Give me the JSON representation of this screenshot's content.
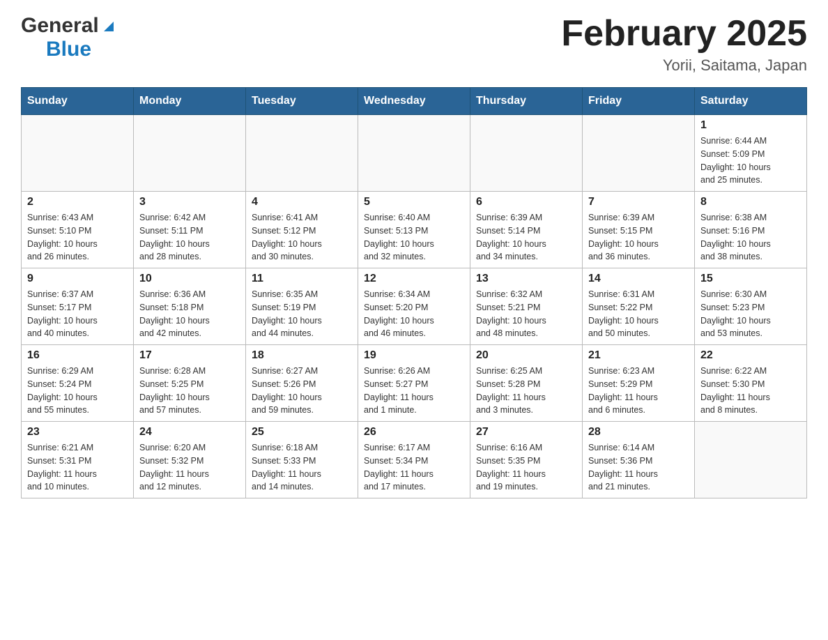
{
  "header": {
    "logo_general": "General",
    "logo_blue": "Blue",
    "month_title": "February 2025",
    "location": "Yorii, Saitama, Japan"
  },
  "days_of_week": [
    "Sunday",
    "Monday",
    "Tuesday",
    "Wednesday",
    "Thursday",
    "Friday",
    "Saturday"
  ],
  "weeks": [
    [
      {
        "day": "",
        "info": ""
      },
      {
        "day": "",
        "info": ""
      },
      {
        "day": "",
        "info": ""
      },
      {
        "day": "",
        "info": ""
      },
      {
        "day": "",
        "info": ""
      },
      {
        "day": "",
        "info": ""
      },
      {
        "day": "1",
        "info": "Sunrise: 6:44 AM\nSunset: 5:09 PM\nDaylight: 10 hours\nand 25 minutes."
      }
    ],
    [
      {
        "day": "2",
        "info": "Sunrise: 6:43 AM\nSunset: 5:10 PM\nDaylight: 10 hours\nand 26 minutes."
      },
      {
        "day": "3",
        "info": "Sunrise: 6:42 AM\nSunset: 5:11 PM\nDaylight: 10 hours\nand 28 minutes."
      },
      {
        "day": "4",
        "info": "Sunrise: 6:41 AM\nSunset: 5:12 PM\nDaylight: 10 hours\nand 30 minutes."
      },
      {
        "day": "5",
        "info": "Sunrise: 6:40 AM\nSunset: 5:13 PM\nDaylight: 10 hours\nand 32 minutes."
      },
      {
        "day": "6",
        "info": "Sunrise: 6:39 AM\nSunset: 5:14 PM\nDaylight: 10 hours\nand 34 minutes."
      },
      {
        "day": "7",
        "info": "Sunrise: 6:39 AM\nSunset: 5:15 PM\nDaylight: 10 hours\nand 36 minutes."
      },
      {
        "day": "8",
        "info": "Sunrise: 6:38 AM\nSunset: 5:16 PM\nDaylight: 10 hours\nand 38 minutes."
      }
    ],
    [
      {
        "day": "9",
        "info": "Sunrise: 6:37 AM\nSunset: 5:17 PM\nDaylight: 10 hours\nand 40 minutes."
      },
      {
        "day": "10",
        "info": "Sunrise: 6:36 AM\nSunset: 5:18 PM\nDaylight: 10 hours\nand 42 minutes."
      },
      {
        "day": "11",
        "info": "Sunrise: 6:35 AM\nSunset: 5:19 PM\nDaylight: 10 hours\nand 44 minutes."
      },
      {
        "day": "12",
        "info": "Sunrise: 6:34 AM\nSunset: 5:20 PM\nDaylight: 10 hours\nand 46 minutes."
      },
      {
        "day": "13",
        "info": "Sunrise: 6:32 AM\nSunset: 5:21 PM\nDaylight: 10 hours\nand 48 minutes."
      },
      {
        "day": "14",
        "info": "Sunrise: 6:31 AM\nSunset: 5:22 PM\nDaylight: 10 hours\nand 50 minutes."
      },
      {
        "day": "15",
        "info": "Sunrise: 6:30 AM\nSunset: 5:23 PM\nDaylight: 10 hours\nand 53 minutes."
      }
    ],
    [
      {
        "day": "16",
        "info": "Sunrise: 6:29 AM\nSunset: 5:24 PM\nDaylight: 10 hours\nand 55 minutes."
      },
      {
        "day": "17",
        "info": "Sunrise: 6:28 AM\nSunset: 5:25 PM\nDaylight: 10 hours\nand 57 minutes."
      },
      {
        "day": "18",
        "info": "Sunrise: 6:27 AM\nSunset: 5:26 PM\nDaylight: 10 hours\nand 59 minutes."
      },
      {
        "day": "19",
        "info": "Sunrise: 6:26 AM\nSunset: 5:27 PM\nDaylight: 11 hours\nand 1 minute."
      },
      {
        "day": "20",
        "info": "Sunrise: 6:25 AM\nSunset: 5:28 PM\nDaylight: 11 hours\nand 3 minutes."
      },
      {
        "day": "21",
        "info": "Sunrise: 6:23 AM\nSunset: 5:29 PM\nDaylight: 11 hours\nand 6 minutes."
      },
      {
        "day": "22",
        "info": "Sunrise: 6:22 AM\nSunset: 5:30 PM\nDaylight: 11 hours\nand 8 minutes."
      }
    ],
    [
      {
        "day": "23",
        "info": "Sunrise: 6:21 AM\nSunset: 5:31 PM\nDaylight: 11 hours\nand 10 minutes."
      },
      {
        "day": "24",
        "info": "Sunrise: 6:20 AM\nSunset: 5:32 PM\nDaylight: 11 hours\nand 12 minutes."
      },
      {
        "day": "25",
        "info": "Sunrise: 6:18 AM\nSunset: 5:33 PM\nDaylight: 11 hours\nand 14 minutes."
      },
      {
        "day": "26",
        "info": "Sunrise: 6:17 AM\nSunset: 5:34 PM\nDaylight: 11 hours\nand 17 minutes."
      },
      {
        "day": "27",
        "info": "Sunrise: 6:16 AM\nSunset: 5:35 PM\nDaylight: 11 hours\nand 19 minutes."
      },
      {
        "day": "28",
        "info": "Sunrise: 6:14 AM\nSunset: 5:36 PM\nDaylight: 11 hours\nand 21 minutes."
      },
      {
        "day": "",
        "info": ""
      }
    ]
  ]
}
